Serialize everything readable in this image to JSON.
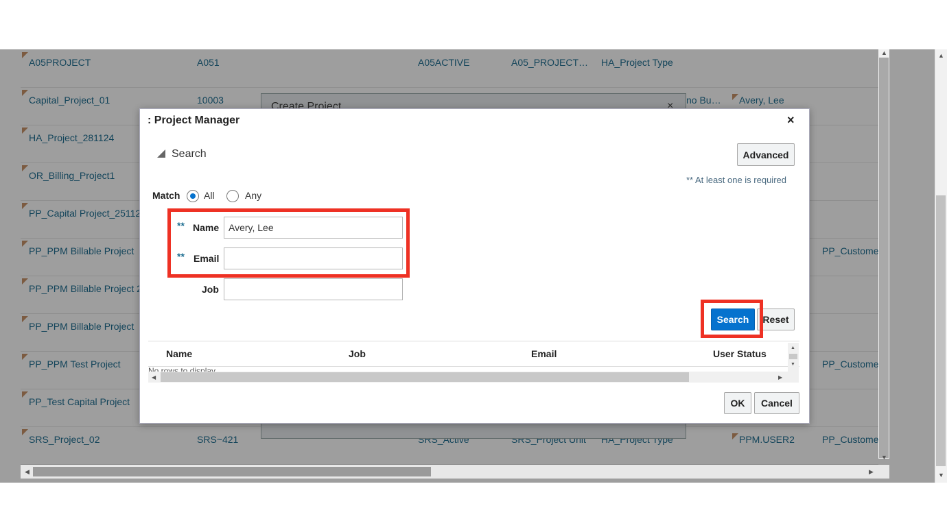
{
  "background_table": {
    "rows": [
      {
        "name": "A05PROJECT",
        "number": "A051",
        "status": "A05ACTIVE",
        "unit": "A05_PROJECT…",
        "type": "HA_Project Type",
        "manager": "",
        "customer": ""
      },
      {
        "name": "Capital_Project_01",
        "number": "10003",
        "status": "",
        "unit": "",
        "type": "",
        "org": "no Bu…",
        "manager": "Avery, Lee",
        "customer": ""
      },
      {
        "name": "HA_Project_281124",
        "number": "",
        "status": "",
        "unit": "",
        "type": "",
        "manager": "",
        "customer": ""
      },
      {
        "name": "OR_Billing_Project1",
        "number": "",
        "status": "",
        "unit": "",
        "type": "",
        "manager": "",
        "customer": ""
      },
      {
        "name": "PP_Capital Project_25112",
        "number": "",
        "status": "",
        "unit": "",
        "type": "",
        "manager": "",
        "customer": ""
      },
      {
        "name": "PP_PPM Billable Project",
        "number": "",
        "status": "",
        "unit": "",
        "type": "",
        "manager": "",
        "customer": "PP_Custome"
      },
      {
        "name": "PP_PPM Billable Project 2",
        "number": "",
        "status": "",
        "unit": "",
        "type": "",
        "manager": "",
        "customer": ""
      },
      {
        "name": "PP_PPM Billable Project",
        "number": "",
        "status": "",
        "unit": "",
        "type": "",
        "manager": "",
        "customer": ""
      },
      {
        "name": "PP_PPM Test Project",
        "number": "",
        "status": "",
        "unit": "",
        "type": "",
        "manager": "",
        "customer": "PP_Custome"
      },
      {
        "name": "PP_Test Capital Project",
        "number": "",
        "status": "",
        "unit": "",
        "type": "",
        "manager": "",
        "customer": ""
      },
      {
        "name": "SRS_Project_02",
        "number": "SRS~421",
        "status": "SRS_Active",
        "unit": "SRS_Project Unit",
        "type": "HA_Project Type",
        "manager": "PPM.USER2",
        "customer": "PP_Custome"
      }
    ]
  },
  "create_project_dialog": {
    "title": "Create Project",
    "close_icon": "×"
  },
  "project_manager_dialog": {
    "title": ": Project Manager",
    "close_icon": "×",
    "search_section_label": "Search",
    "advanced_button": "Advanced",
    "required_note": "** At least one is required",
    "match_label": "Match",
    "match_options": [
      "All",
      "Any"
    ],
    "match_selected": "All",
    "fields": {
      "name": {
        "required_marker": "**",
        "label": "Name",
        "value": "Avery, Lee"
      },
      "email": {
        "required_marker": "**",
        "label": "Email",
        "value": ""
      },
      "job": {
        "label": "Job",
        "value": ""
      }
    },
    "search_button": "Search",
    "reset_button": "Reset",
    "results_table": {
      "columns": [
        "Name",
        "Job",
        "Email",
        "User Status"
      ],
      "empty_message": "No rows to display"
    },
    "ok_button": "OK",
    "cancel_button": "Cancel"
  },
  "highlight_color": "#ee3124",
  "accent_color": "#0572ce"
}
